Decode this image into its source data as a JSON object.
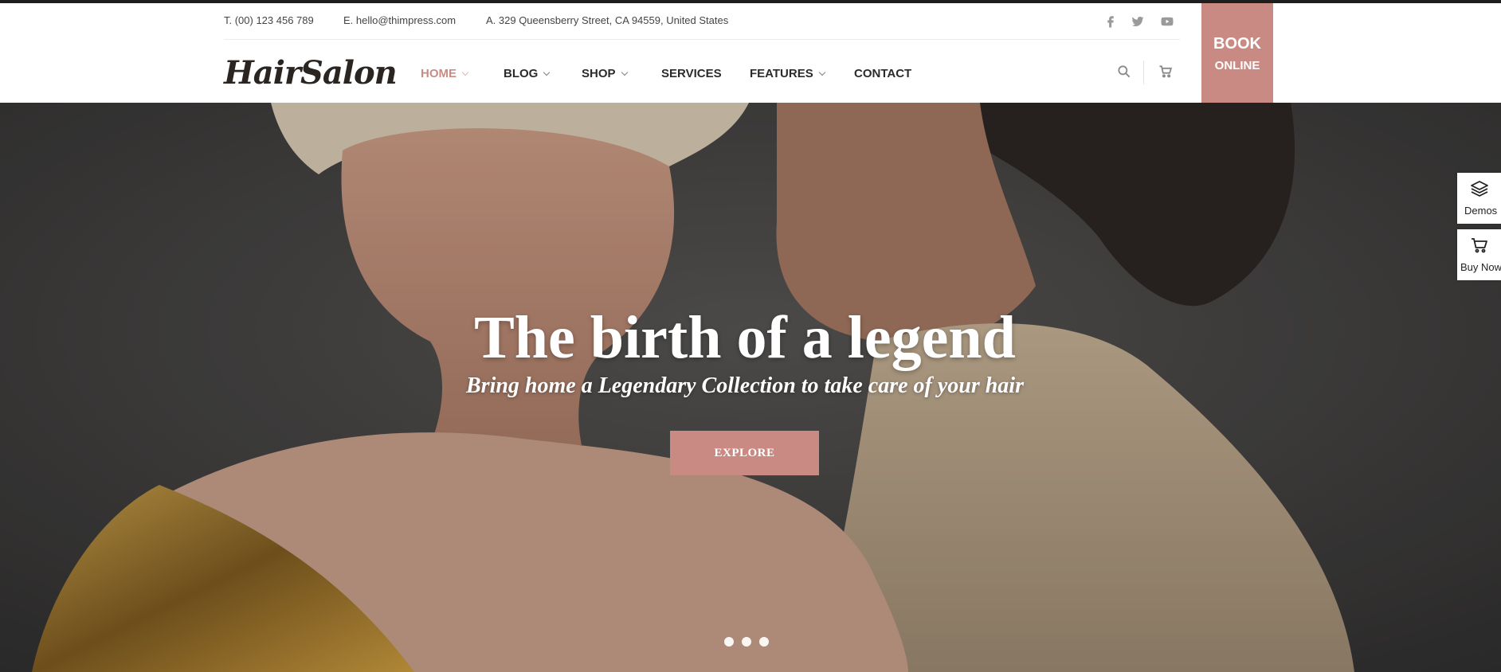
{
  "topbar": {
    "phone": "T. (00) 123 456 789",
    "email": "E. hello@thimpress.com",
    "address": "A. 329 Queensberry Street, CA 94559, United States",
    "social": [
      "facebook-icon",
      "twitter-icon",
      "youtube-icon"
    ]
  },
  "logo": "HairSalon",
  "nav": {
    "items": [
      {
        "label": "HOME",
        "active": true,
        "dropdown": true
      },
      {
        "label": "BLOG",
        "dropdown": true
      },
      {
        "label": "SHOP",
        "dropdown": true
      },
      {
        "label": "SERVICES",
        "dropdown": false
      },
      {
        "label": "FEATURES",
        "dropdown": true
      },
      {
        "label": "CONTACT",
        "dropdown": false
      }
    ],
    "icons": [
      "search-icon",
      "cart-icon"
    ]
  },
  "book": {
    "line1": "BOOK",
    "line2": "ONLINE"
  },
  "hero": {
    "title": "The birth of a legend",
    "subtitle": "Bring home a Legendary Collection to take care of your hair",
    "button": "EXPLORE",
    "slides": 3
  },
  "side": {
    "demos": "Demos",
    "buy": "Buy Now"
  },
  "colors": {
    "accent": "#c98c85",
    "book_bg": "#c98a83",
    "hero_bg": "#3b3a3a"
  }
}
